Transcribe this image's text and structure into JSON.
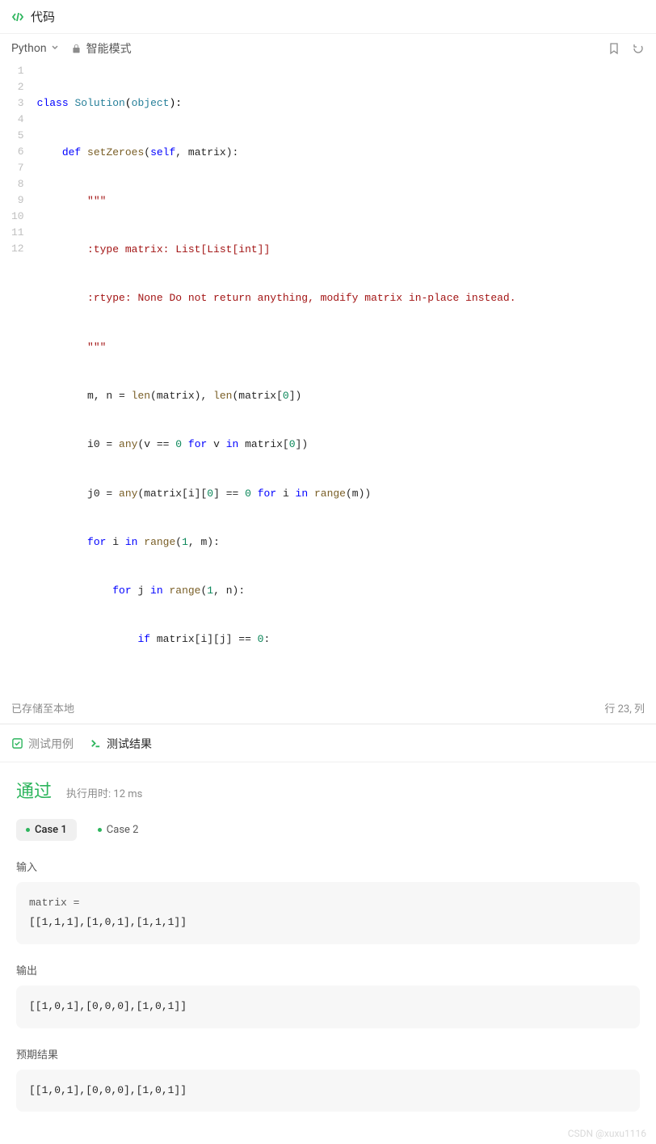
{
  "header": {
    "title": "代码"
  },
  "toolbar": {
    "language": "Python",
    "mode": "智能模式"
  },
  "editor": {
    "lines": [
      1,
      2,
      3,
      4,
      5,
      6,
      7,
      8,
      9,
      10,
      11,
      12
    ],
    "code": {
      "l1": {
        "kw1": "class",
        "cls": "Solution",
        "par1": "(",
        "obj": "object",
        "par2": "):"
      },
      "l2": {
        "kw1": "def",
        "fn": "setZeroes",
        "par1": "(",
        "self": "self",
        "comma": ", ",
        "arg": "matrix",
        "par2": "):"
      },
      "l3": {
        "str": "\"\"\""
      },
      "l4": {
        "str": ":type matrix: List[List[int]]"
      },
      "l5": {
        "str": ":rtype: None Do not return anything, modify matrix in-place instead."
      },
      "l6": {
        "str": "\"\"\""
      },
      "l7": {
        "a": "m, n = ",
        "fn1": "len",
        "b": "(matrix), ",
        "fn2": "len",
        "c": "(matrix[",
        "n0": "0",
        "d": "])"
      },
      "l8": {
        "a": "i0 = ",
        "fn1": "any",
        "b": "(v == ",
        "n0": "0",
        "c": " ",
        "kw1": "for",
        "d": " v ",
        "kw2": "in",
        "e": " matrix[",
        "n1": "0",
        "f": "])"
      },
      "l9": {
        "a": "j0 = ",
        "fn1": "any",
        "b": "(matrix[i][",
        "n0": "0",
        "c": "] == ",
        "n1": "0",
        "d": " ",
        "kw1": "for",
        "e": " i ",
        "kw2": "in",
        "f": " ",
        "fn2": "range",
        "g": "(m))"
      },
      "l10": {
        "kw1": "for",
        "a": " i ",
        "kw2": "in",
        "b": " ",
        "fn1": "range",
        "c": "(",
        "n0": "1",
        "d": ", m):"
      },
      "l11": {
        "kw1": "for",
        "a": " j ",
        "kw2": "in",
        "b": " ",
        "fn1": "range",
        "c": "(",
        "n0": "1",
        "d": ", n):"
      },
      "l12": {
        "kw1": "if",
        "a": " matrix[i][j] == ",
        "n0": "0",
        "b": ":"
      }
    }
  },
  "status": {
    "save": "已存储至本地",
    "cursor": "行 23,  列"
  },
  "tabs": {
    "testcases": "测试用例",
    "results": "测试结果"
  },
  "result": {
    "pass": "通过",
    "runtime": "执行用时: 12 ms",
    "cases": {
      "c1": "Case 1",
      "c2": "Case 2"
    },
    "input": {
      "label": "输入",
      "var": "matrix =",
      "val": "[[1,1,1],[1,0,1],[1,1,1]]"
    },
    "output": {
      "label": "输出",
      "val": "[[1,0,1],[0,0,0],[1,0,1]]"
    },
    "expected": {
      "label": "预期结果",
      "val": "[[1,0,1],[0,0,0],[1,0,1]]"
    }
  },
  "watermark": "CSDN @xuxu1116"
}
